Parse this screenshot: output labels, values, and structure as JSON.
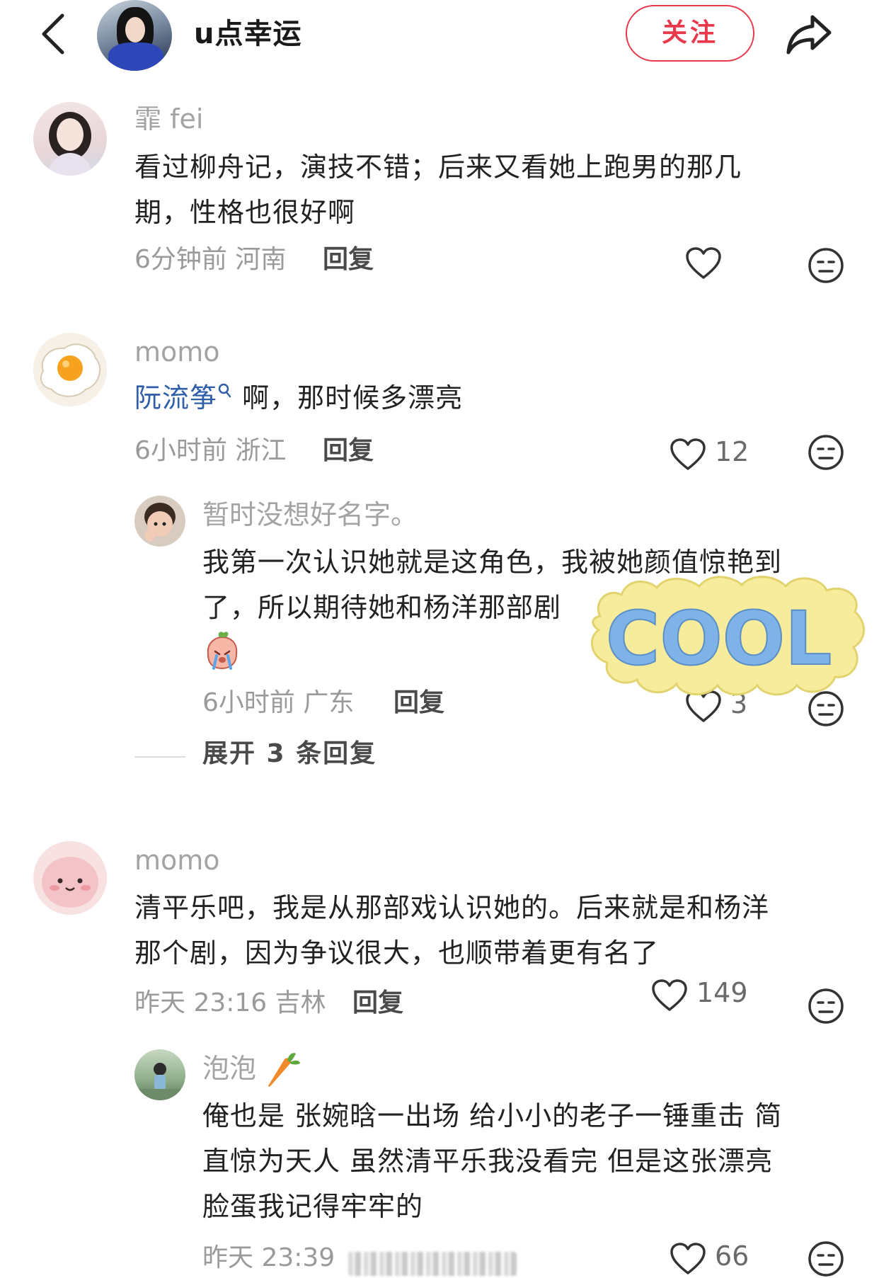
{
  "header": {
    "username": "u点幸运",
    "follow_label": "关注"
  },
  "comments": [
    {
      "nick": "霏 fei",
      "text_line1": "看过柳舟记，演技不错；后来又看她上跑男的那几",
      "text_line2": "期，性格也很好啊",
      "time": "6分钟前 河南",
      "reply_label": "回复",
      "likes": ""
    },
    {
      "nick": "momo",
      "mention": "阮流筝",
      "text": "啊，那时候多漂亮",
      "time": "6小时前 浙江",
      "reply_label": "回复",
      "likes": "12",
      "sub_reply": {
        "nick": "暂时没想好名字。",
        "text_line1": "我第一次认识她就是这角色，我被她颜值惊艳到",
        "text_line2": "了，所以期待她和杨洋那部剧",
        "time": "6小时前 广东",
        "reply_label": "回复",
        "likes": "3"
      },
      "expand_label": "展开 3 条回复"
    },
    {
      "nick": "momo",
      "text_line1": "清平乐吧，我是从那部戏认识她的。后来就是和杨洋",
      "text_line2": "那个剧，因为争议很大，也顺带着更有名了",
      "time": "昨天 23:16 吉林",
      "reply_label": "回复",
      "likes": "149",
      "sub_reply": {
        "nick": "泡泡",
        "text_line1": "俺也是 张婉晗一出场 给小小的老子一锤重击 简",
        "text_line2": "直惊为天人 虽然清平乐我没看完 但是这张漂亮",
        "text_line3": "脸蛋我记得牢牢的",
        "time": "昨天 23:39",
        "likes": "66"
      }
    }
  ],
  "sticker_text": "COOL",
  "icons": {
    "back": "chevron-left-icon",
    "share": "share-arrow-icon",
    "like": "heart-icon",
    "dislike": "neutral-face-icon",
    "carrot": "carrot-emoji"
  },
  "colors": {
    "accent": "#e8384a",
    "mention": "#2f5fa8",
    "meta_gray": "#9a9a9a"
  }
}
